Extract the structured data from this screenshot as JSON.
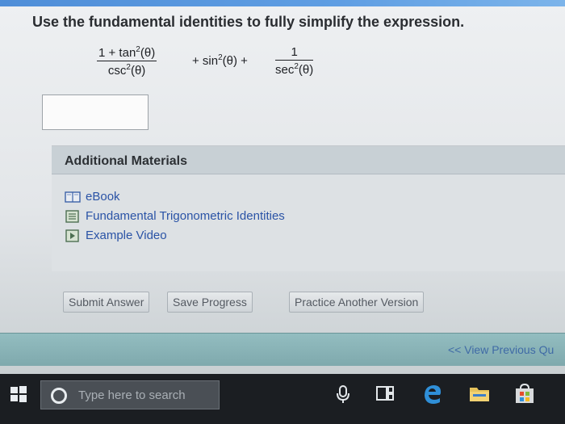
{
  "question": {
    "prompt": "Use the fundamental identities to fully simplify the expression.",
    "term1": {
      "numerator": "1 + tan",
      "numerator_tail": "(θ)",
      "denominator": "csc",
      "denominator_tail": "(θ)"
    },
    "term2": {
      "prefix": "+ sin",
      "tail": "(θ) +"
    },
    "term3": {
      "numerator": "1",
      "denominator": "sec",
      "denominator_tail": "(θ)"
    },
    "exponent": "2",
    "answer_value": ""
  },
  "materials": {
    "title": "Additional Materials",
    "links": [
      {
        "label": "eBook",
        "icon": "book-icon"
      },
      {
        "label": "Fundamental Trigonometric Identities",
        "icon": "document-icon"
      },
      {
        "label": "Example Video",
        "icon": "video-icon"
      }
    ]
  },
  "buttons": {
    "submit": "Submit Answer",
    "save": "Save Progress",
    "practice": "Practice Another Version"
  },
  "navigation": {
    "previous": "<< View Previous Qu"
  },
  "taskbar": {
    "search_placeholder": "Type here to search",
    "icons": [
      "windows-start-icon",
      "cortana-icon",
      "microphone-icon",
      "task-view-icon",
      "edge-icon",
      "file-explorer-icon",
      "store-icon"
    ]
  },
  "colors": {
    "accent": "#4f8ed8",
    "link": "#2a53a6",
    "taskbar": "#1b1e22",
    "nav_bar": "#8bb5b9"
  }
}
